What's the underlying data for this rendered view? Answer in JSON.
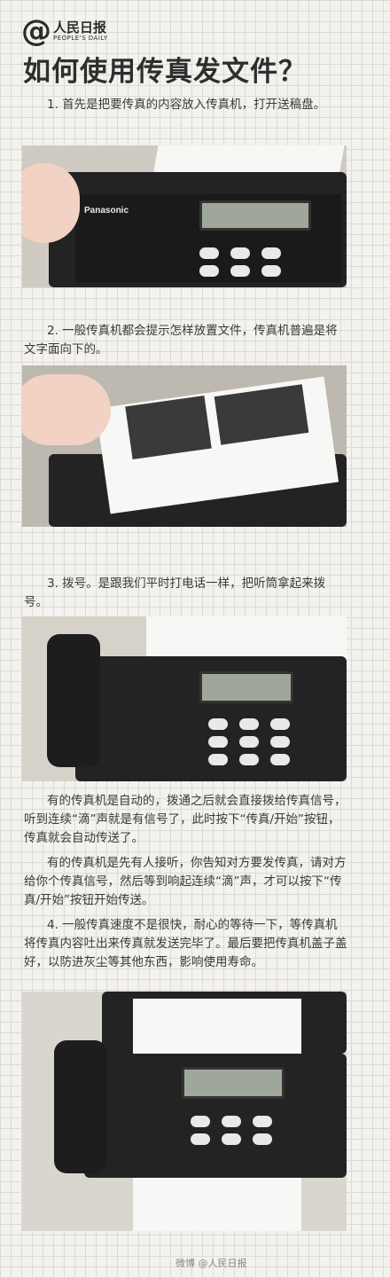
{
  "logo": {
    "at": "@",
    "name_cn": "人民日报",
    "name_en": "PEOPLE'S DAILY"
  },
  "title": "如何使用传真发文件？",
  "steps": [
    "1. 首先是把要传真的内容放入传真机，打开送稿盘。",
    "2. 一般传真机都会提示怎样放置文件，传真机普遍是将文字面向下的。",
    "3. 拨号。是跟我们平时打电话一样，把听筒拿起来拨号。",
    "有的传真机是自动的，拨通之后就会直接拨给传真信号，听到连续“滴”声就是有信号了，此时按下“传真/开始”按钮，传真就会自动传送了。",
    "有的传真机是先有人接听，你告知对方要发传真，请对方给你个传真信号，然后等到响起连续“滴”声，才可以按下“传真/开始”按钮开始传送。",
    "4. 一般传真速度不是很快，耐心的等待一下，等传真机将传真内容吐出来传真就发送完毕了。最后要把传真机盖子盖好，以防进灰尘等其他东西，影响使用寿命。"
  ],
  "photo_brand": "Panasonic",
  "footer": "微博 @人民日报"
}
